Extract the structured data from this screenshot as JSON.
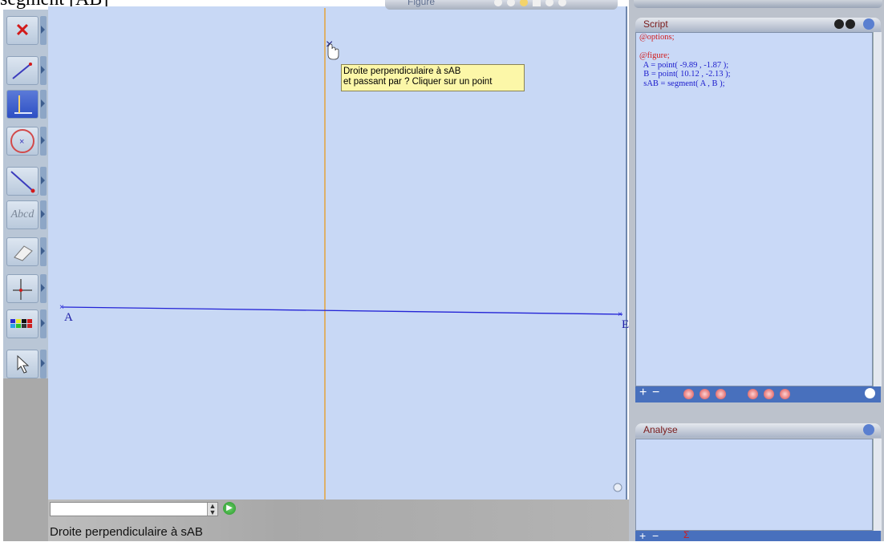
{
  "top_cropped_text": "segment [AB]",
  "toolbar": {
    "tools": [
      {
        "name": "delete-icon"
      },
      {
        "name": "segment-icon"
      },
      {
        "name": "perpendicular-icon",
        "active": true
      },
      {
        "name": "circle-icon"
      },
      {
        "name": "vector-icon"
      },
      {
        "name": "text-icon",
        "label": "Abcd"
      },
      {
        "name": "eraser-icon"
      },
      {
        "name": "axes-icon"
      },
      {
        "name": "color-palette-icon"
      },
      {
        "name": "pointer-icon"
      }
    ]
  },
  "figure": {
    "header_label": "Figure",
    "tooltip_line1": "Droite perpendiculaire à sAB",
    "tooltip_line2": "et passant par ? Cliquer sur un point",
    "point_a_label": "A",
    "point_b_label": "E"
  },
  "bottom": {
    "command_value": "",
    "status_text": "Droite perpendiculaire à sAB"
  },
  "right_panel": {
    "script_title": "Script",
    "script_line1": "@options;",
    "script_line2": "@figure;",
    "script_line3": "  A = point( -9.89 , -1.87 );",
    "script_line4": "  B = point( 10.12 , -2.13 );",
    "script_line5": "  sAB = segment( A , B );",
    "analyse_title": "Analyse"
  },
  "colors": {
    "canvas": "#c8d8f5",
    "segment": "#2323d6",
    "perpendicular_line": "#e4a23b",
    "tooltip_bg": "#fcf7a8"
  }
}
